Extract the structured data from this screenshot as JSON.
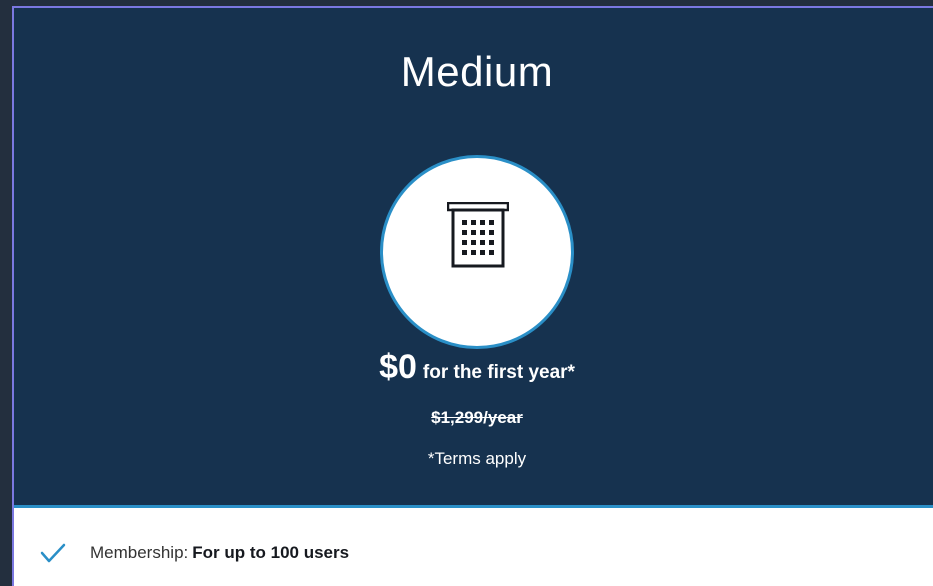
{
  "plan": {
    "title": "Medium",
    "icon": "building-icon",
    "price_amount": "$0",
    "price_suffix": "for the first year*",
    "original_price": "$1,299/year",
    "terms_note": "*Terms apply"
  },
  "features": [
    {
      "icon": "check-icon",
      "label": "Membership:",
      "value": "For up to 100 users"
    }
  ],
  "colors": {
    "header_bg": "#16324f",
    "accent": "#2a8fc7",
    "card_border": "#7b78e0",
    "page_bg": "#232f3e"
  }
}
